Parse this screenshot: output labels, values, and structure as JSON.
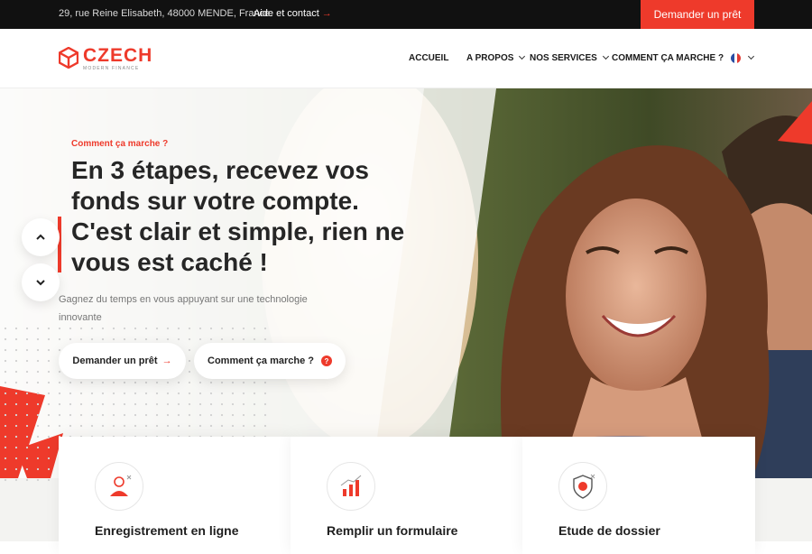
{
  "topbar": {
    "address": "29, rue Reine Elisabeth, 48000 MENDE, France.",
    "help_label": "Aide et contact",
    "help_arrow": "→",
    "cta_label": "Demander un prêt"
  },
  "logo": {
    "name": "CZECH",
    "tagline": "MODERN FINANCE"
  },
  "nav": {
    "items": [
      {
        "label": "ACCUEIL"
      },
      {
        "label": "A PROPOS"
      },
      {
        "label": "NOS SERVICES"
      },
      {
        "label": "COMMENT ÇA MARCHE ?"
      }
    ]
  },
  "hero": {
    "eyebrow": "Comment ça marche ?",
    "headline": "En 3 étapes, recevez vos fonds sur votre compte. C'est clair et simple, rien ne vous est caché !",
    "subtitle": "Gagnez du temps en vous appuyant sur une technologie innovante",
    "primary_button": "Demander un prêt",
    "primary_arrow": "→",
    "secondary_button": "Comment ça marche ?",
    "secondary_icon": "?"
  },
  "cards": [
    {
      "title": "Enregistrement en ligne",
      "icon": "user-icon"
    },
    {
      "title": "Remplir un formulaire",
      "icon": "chart-icon"
    },
    {
      "title": "Etude de dossier",
      "icon": "shield-icon"
    }
  ],
  "colors": {
    "accent": "#ee3a2b",
    "topbar_bg": "#111111",
    "text": "#262626"
  }
}
